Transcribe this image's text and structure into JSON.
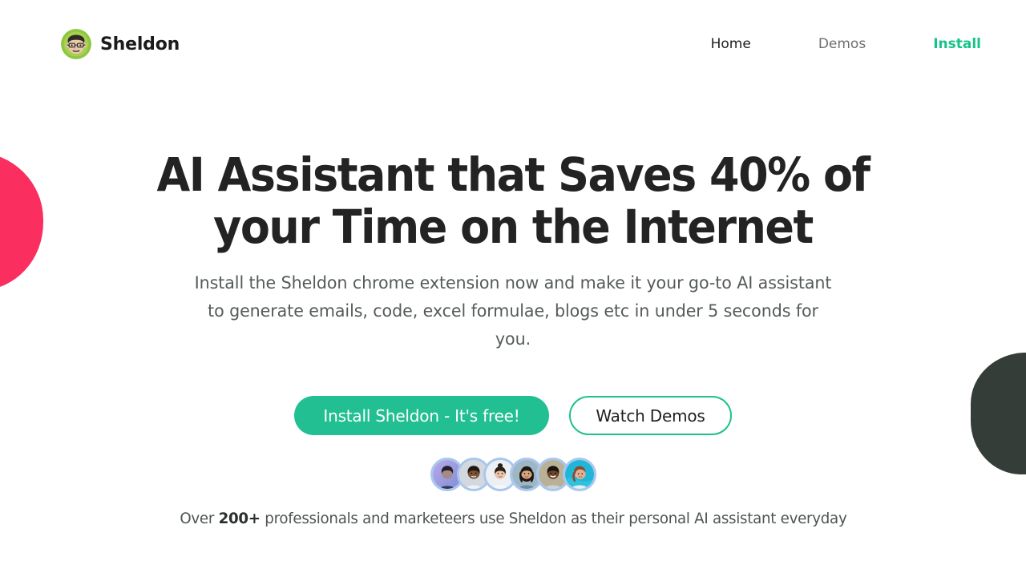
{
  "colors": {
    "accent_green": "#22BF92",
    "nav_accent_green": "#16C48B",
    "blob_pink": "#FB2E60",
    "blob_dark": "#343D38",
    "headline": "#232323",
    "subhead": "#555a5b",
    "avatar_ring": "#A9C7EE",
    "background": "#ffffff"
  },
  "header": {
    "brand": {
      "name": "Sheldon",
      "logo_icon": "sheldon-face-avatar-icon"
    },
    "nav": [
      {
        "label": "Home",
        "state": "default"
      },
      {
        "label": "Demos",
        "state": "muted"
      },
      {
        "label": "Install",
        "state": "accent"
      }
    ]
  },
  "hero": {
    "headline": "AI Assistant that Saves 40% of your Time on the Internet",
    "subheadline": "Install the Sheldon chrome extension now and make it your go-to AI assistant to generate emails, code, excel formulae, blogs etc in under 5 seconds for you.",
    "primary_cta": "Install Sheldon - It's free!",
    "secondary_cta": "Watch Demos",
    "social_proof": {
      "prefix": "Over ",
      "count": "200+",
      "suffix": " professionals and marketeers use Sheldon as their personal AI assistant everyday",
      "avatar_count": 6,
      "avatars": [
        {
          "name": "user-avatar-1",
          "skin": "#c9a898",
          "hair": "#2b2b3a",
          "bg": "#9aa4d6",
          "shirt": "#2f3b52"
        },
        {
          "name": "user-avatar-2",
          "skin": "#7a5338",
          "hair": "#23180f",
          "bg": "#cfd6db",
          "shirt": "#eef1f3"
        },
        {
          "name": "user-avatar-3",
          "skin": "#e8c4ac",
          "hair": "#2a2018",
          "bg": "#eceff1",
          "shirt": "#f4f6f7"
        },
        {
          "name": "user-avatar-4",
          "skin": "#d8a77f",
          "hair": "#1d1510",
          "bg": "#9fb6c4",
          "shirt": "#6d8e9e"
        },
        {
          "name": "user-avatar-5",
          "skin": "#6b452c",
          "hair": "#1a120c",
          "bg": "#b9b197",
          "shirt": "#cdd3d6"
        },
        {
          "name": "user-avatar-6",
          "skin": "#e2b193",
          "hair": "#8a4a2c",
          "bg": "#1fb6d8",
          "shirt": "#1fb6d8"
        }
      ]
    }
  },
  "decorations": {
    "pink_blob": "pink-blob-decoration",
    "dark_blob": "dark-blob-decoration"
  }
}
